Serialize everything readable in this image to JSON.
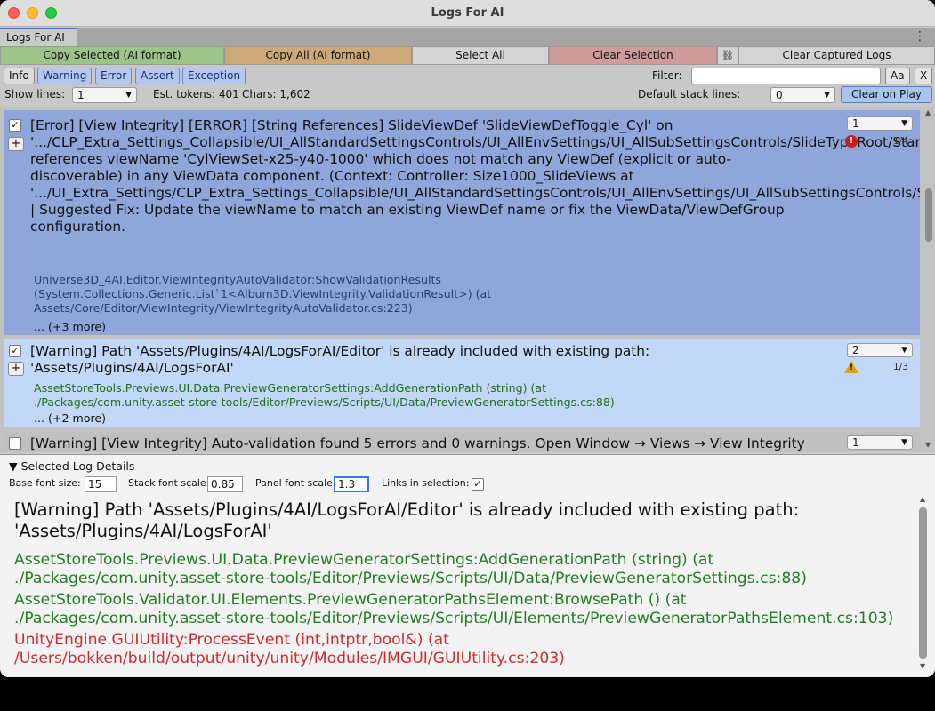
{
  "window": {
    "title": "Logs For AI"
  },
  "tab": {
    "label": "Logs For AI",
    "menu_glyph": "⋮"
  },
  "toolbar": {
    "copy_selected": "Copy Selected (AI format)",
    "copy_all": "Copy All (AI format)",
    "select_all": "Select All",
    "clear_selection": "Clear Selection",
    "link_glyph": "⛓",
    "clear_captured": "Clear Captured Logs"
  },
  "filters": {
    "info": "Info",
    "warning": "Warning",
    "error": "Error",
    "assert": "Assert",
    "exception": "Exception",
    "filter_label": "Filter:",
    "filter_value": "",
    "aa": "Aa",
    "clear": "X"
  },
  "options": {
    "show_lines_label": "Show lines:",
    "show_lines_value": "1",
    "est_tokens": "Est. tokens: 401",
    "chars": "Chars: 1,602",
    "default_stack_label": "Default stack lines:",
    "default_stack_value": "0",
    "clear_on_play": "Clear on Play"
  },
  "entries": [
    {
      "checked": "✓",
      "plus": "+",
      "message": "[Error] [View Integrity] [ERROR] [String References] SlideViewDef 'SlideViewDefToggle_Cyl' on\n'.../CLP_Extra_Settings_Collapsible/UI_AllStandardSettingsControls/UI_AllEnvSettings/UI_AllSubSettingsControls/SlideTypeRoot/StarTypeRoot/UI_AllSimpleSlideViews/AllSimpleSlideViews/Size1000_SlideViews/SlideViewDefToggle_Cyl' references viewName 'CylViewSet-x25-y40-1000' which does not match any ViewDef (explicit or auto-discoverable) in any ViewData component. (Context: Controller: Size1000_SlideViews at '.../UI_Extra_Settings/CLP_Extra_Settings_Collapsible/UI_AllStandardSettingsControls/UI_AllEnvSettings/UI_AllSubSettingsControls/SlideTypeRoot/StarTypeRoot/UI_AllSimpleSlideViews/AllSimpleSlideViews/Size1000_SlideViews') | Suggested Fix: Update the viewName to match an existing ViewDef name or fix the ViewData/ViewDefGroup configuration.",
      "stack": "Universe3D_4AI.Editor.ViewIntegrityAutoValidator:ShowValidationResults\n(System.Collections.Generic.List`1<Album3D.ViewIntegrity.ValidationResult>) (at\nAssets/Core/Editor/ViewIntegrity/ViewIntegrityAutoValidator.cs:223)",
      "more": "... (+3 more)",
      "lines_value": "1",
      "count": "1/4",
      "icon": "error-icon"
    },
    {
      "checked": "✓",
      "plus": "+",
      "message": "[Warning] Path 'Assets/Plugins/4AI/LogsForAI/Editor' is already included with existing path:\n'Assets/Plugins/4AI/LogsForAI'",
      "stack": "AssetStoreTools.Previews.UI.Data.PreviewGeneratorSettings:AddGenerationPath (string) (at\n./Packages/com.unity.asset-store-tools/Editor/Previews/Scripts/UI/Data/PreviewGeneratorSettings.cs:88)",
      "more": "... (+2 more)",
      "lines_value": "2",
      "count": "1/3",
      "icon": "warning-icon"
    },
    {
      "checked": "",
      "message": "[Warning] [View Integrity] Auto-validation found 5 errors and 0 warnings. Open Window → Views → View Integrity",
      "lines_value": "1"
    }
  ],
  "details": {
    "header": "Selected Log Details",
    "base_font_label": "Base font size:",
    "base_font_value": "15",
    "stack_scale_label": "Stack font scale",
    "stack_scale_value": "0.85",
    "panel_scale_label": "Panel font scale:",
    "panel_scale_value": "1.3",
    "links_label": "Links in selection:",
    "links_checked": "✓",
    "message": "[Warning] Path 'Assets/Plugins/4AI/LogsForAI/Editor' is already included with existing path:\n'Assets/Plugins/4AI/LogsForAI'",
    "stack": [
      {
        "text": "AssetStoreTools.Previews.UI.Data.PreviewGeneratorSettings:AddGenerationPath (string) (at\n./Packages/com.unity.asset-store-tools/Editor/Previews/Scripts/UI/Data/PreviewGeneratorSettings.cs:88)",
        "color": "green"
      },
      {
        "text": "AssetStoreTools.Validator.UI.Elements.PreviewGeneratorPathsElement:BrowsePath () (at\n./Packages/com.unity.asset-store-tools/Editor/Previews/Scripts/UI/Elements/PreviewGeneratorPathsElement.cs:103)",
        "color": "green"
      },
      {
        "text": "UnityEngine.GUIUtility:ProcessEvent (int,intptr,bool&) (at\n/Users/bokken/build/output/unity/unity/Modules/IMGUI/GUIUtility.cs:203)",
        "color": "red"
      }
    ]
  },
  "colors": {
    "copy_selected_bg": "#9bc38a",
    "copy_all_bg": "#cda878",
    "clear_selection_bg": "#cf9b9b",
    "error_entry_bg": "#8fa6da",
    "warning_entry_bg": "#c3d8f6",
    "stack_green": "#237e23",
    "stack_red": "#d22b2b"
  }
}
